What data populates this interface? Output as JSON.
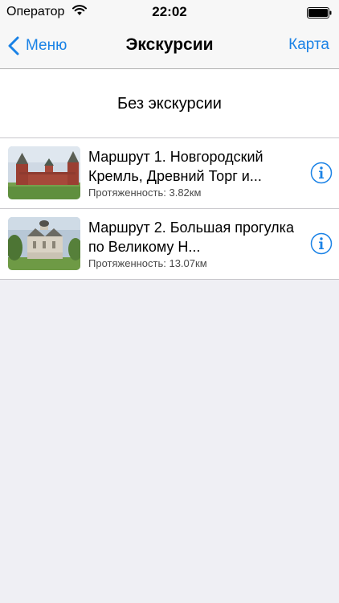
{
  "status_bar": {
    "carrier": "Оператор",
    "time": "22:02",
    "wifi_icon": "wifi-icon",
    "battery_icon": "battery-icon"
  },
  "nav": {
    "back_label": "Меню",
    "title": "Экскурсии",
    "right_label": "Карта"
  },
  "no_tour": {
    "label": "Без экскурсии"
  },
  "routes": [
    {
      "title": "Маршрут 1. Новгородский Кремль, Древний Торг и...",
      "length": "Протяженность: 3.82км",
      "thumbnail": "kremlin-wall-photo",
      "info_icon": "info-icon"
    },
    {
      "title": "Маршрут 2.  Большая прогулка по Великому Н...",
      "length": "Протяженность: 13.07км",
      "thumbnail": "white-church-photo",
      "info_icon": "info-icon"
    }
  ],
  "colors": {
    "accent": "#1a82e6",
    "background": "#efeff4",
    "bar": "#f7f7f7"
  }
}
